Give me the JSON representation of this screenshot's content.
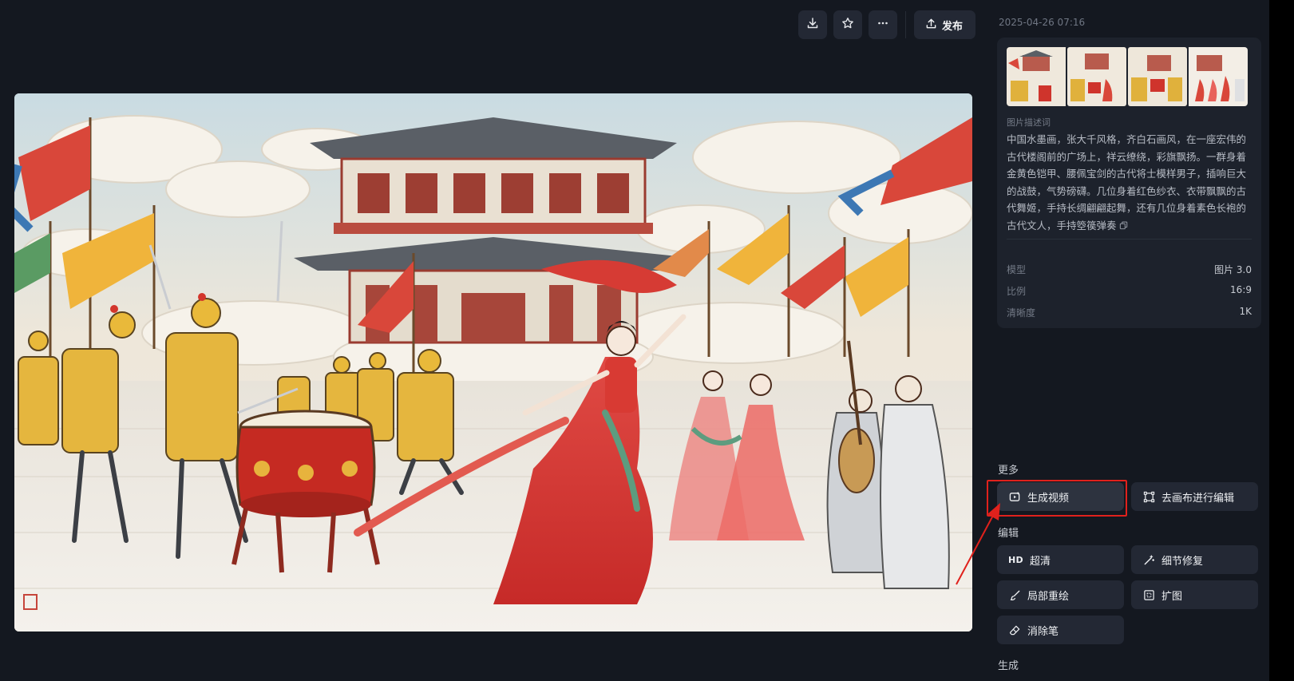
{
  "toolbar": {
    "download_icon": "download-icon",
    "favorite_icon": "star-icon",
    "more_icon": "more-icon",
    "publish_label": "发布"
  },
  "main_image": {
    "alt": "中国水墨画，张大千风格，齐白石画风，在一座宏伟的古代楼阁前的广场上，祥云缭绕，彩旗飘扬。"
  },
  "side": {
    "timestamp": "2025-04-26 07:16",
    "prompt_label": "图片描述词",
    "prompt_text": "中国水墨画，张大千风格，齐白石画风，在一座宏伟的古代楼阁前的广场上，祥云缭绕，彩旗飘扬。一群身着金黄色铠甲、腰佩宝剑的古代将士模样男子，插响巨大的战鼓，气势磅礴。几位身着红色纱衣、衣带飘飘的古代舞姬，手持长绸翩翩起舞，还有几位身着素色长袍的古代文人，手持箜篌弹奏",
    "copy_icon": "copy-icon",
    "meta": [
      {
        "key": "模型",
        "value": "图片 3.0"
      },
      {
        "key": "比例",
        "value": "16:9"
      },
      {
        "key": "清晰度",
        "value": "1K"
      }
    ],
    "more_title": "更多",
    "edit_title": "编辑",
    "generate_title": "生成",
    "actions": {
      "generate_video": "生成视频",
      "canvas_edit": "去画布进行编辑",
      "hd_badge": "HD",
      "upscale": "超清",
      "detail_fix": "细节修复",
      "inpaint": "局部重绘",
      "outpaint": "扩图",
      "eraser": "消除笔"
    }
  },
  "colors": {
    "background": "#141820",
    "card": "#1d222c",
    "button": "#232834",
    "highlight": "#e0211c"
  }
}
